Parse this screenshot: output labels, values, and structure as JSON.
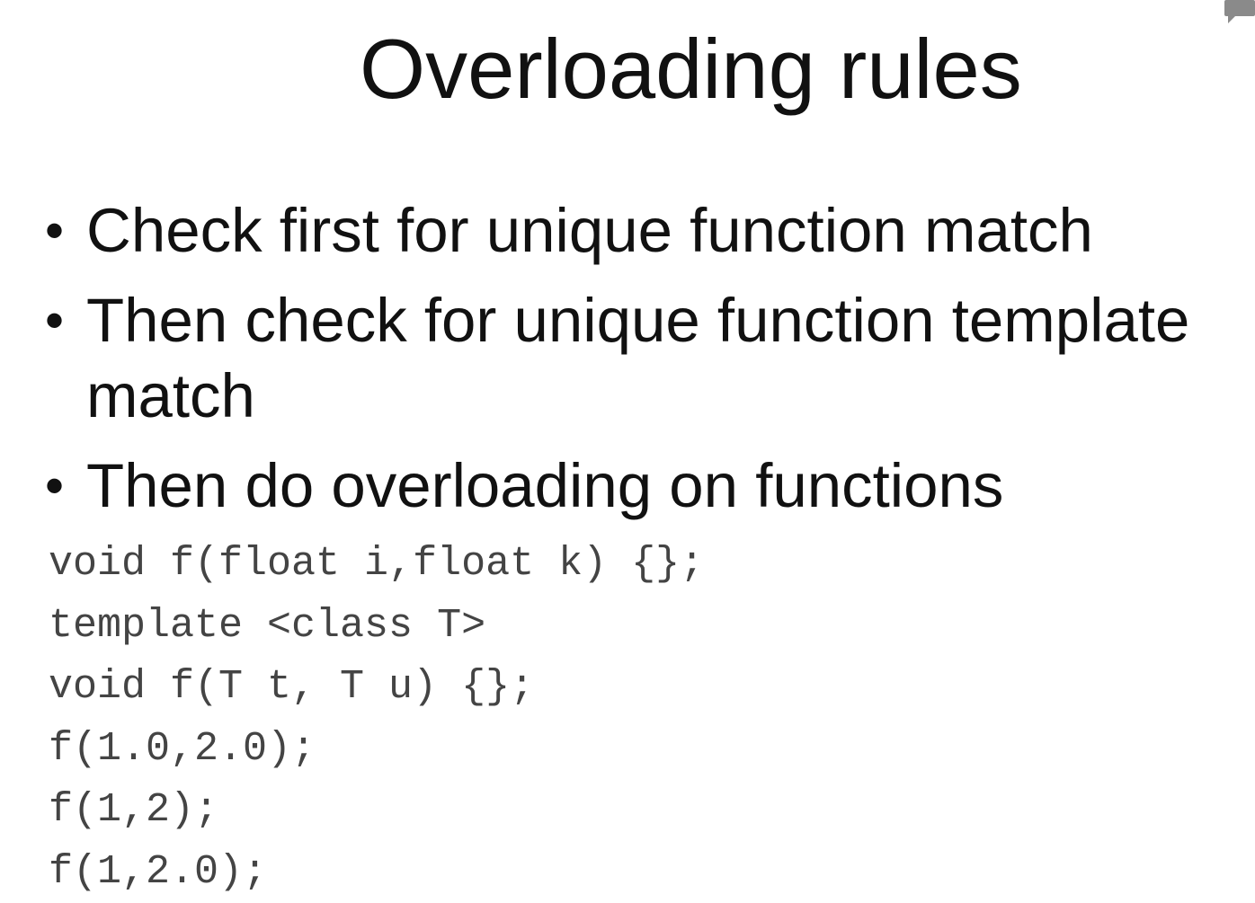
{
  "slide": {
    "title": "Overloading rules",
    "bullets": [
      "Check first for unique function match",
      "Then check for unique function template match",
      "Then do overloading on functions"
    ],
    "bullet_glyph": "•",
    "code_lines": [
      "void f(float i,float k) {};",
      "template <class T>",
      "void f(T t, T u) {};",
      "f(1.0,2.0);",
      "f(1,2);",
      "f(1,2.0);"
    ],
    "corner_icon": "comment-icon",
    "colors": {
      "background": "#ffffff",
      "text": "#111111",
      "code": "#444444"
    }
  }
}
